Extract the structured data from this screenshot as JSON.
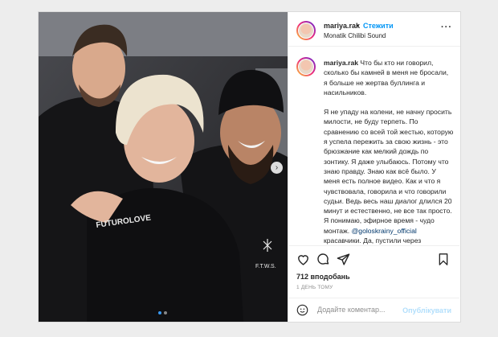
{
  "post": {
    "username": "mariya.rak",
    "separator": "•",
    "follow_label": "Стежити",
    "audio": "Monatik Chilibi Sound",
    "more_icon": "more-icon",
    "caption_username": "mariya.rak",
    "caption_p1": " Что бы кто ни говорил, сколько бы камней в меня не бросали, я больше не жертва буллинга и насильников.",
    "caption_p2_start": "Я не упаду на колени, не начну просить милости, не буду терпеть. По сравнению со всей той жестью, которую я успела пережить за свою жизнь - это брюзжание как мелкий дождь по зонтику. Я даже улыбаюсь. Потому что знаю правду. Знаю как всё было. У меня есть полное видео. Как и что я чувствовала, говорила и что говорили судьи. Ведь весь наш диалог длился 20 минут и естественно, не все так просто. Я понимаю, эфирное время - чудо монтаж. ",
    "caption_mention": "@goloskrainy_official",
    "caption_p2_end": " красавчики. Да, пустили через",
    "likes": "712 вподобань",
    "time": "1 ДЕНЬ ТОМУ",
    "comment_placeholder": "Додайте коментар...",
    "post_label": "Опублікувати",
    "photo_text_sweater1": "FUTUROLOVE",
    "photo_text_sweater2": "F.T.W.S.",
    "carousel_count": 2,
    "carousel_active": 0
  },
  "colors": {
    "accent": "#0095f6",
    "post_disabled": "#b2dffc",
    "link": "#00376b"
  }
}
